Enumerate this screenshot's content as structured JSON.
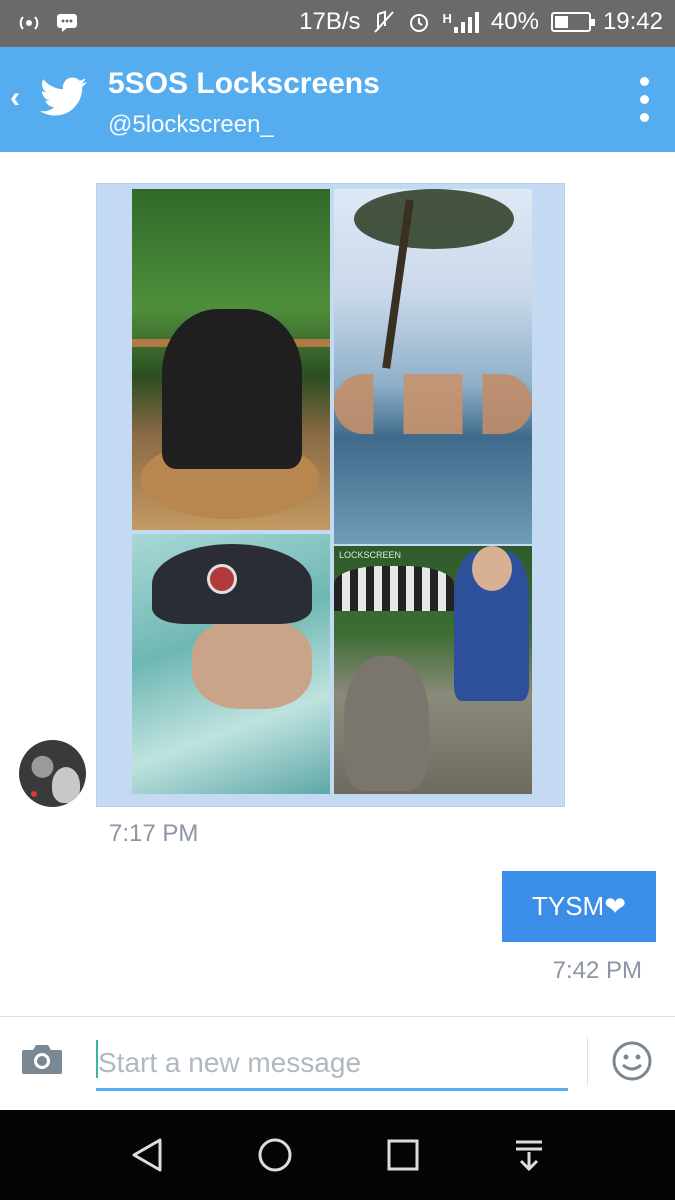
{
  "status_bar": {
    "speed": "17B/s",
    "network_type": "H",
    "battery_percent": "40%",
    "battery_level": 0.4,
    "time": "19:42",
    "icons": [
      "hotspot-icon",
      "bbm-icon",
      "mute-icon",
      "alarm-icon",
      "signal-icon",
      "battery-icon"
    ]
  },
  "header": {
    "title": "5SOS Lockscreens",
    "handle": "@5lockscreen_",
    "accent": "#55acee"
  },
  "conversation": {
    "incoming": {
      "image_watermark": "LOCKSCREEN",
      "time": "7:17 PM"
    },
    "outgoing": {
      "text": "TYSM❤",
      "time": "7:42 PM",
      "color": "#3a8ee8"
    }
  },
  "composer": {
    "placeholder": "Start a new message",
    "value": ""
  },
  "nav_bar": {
    "icons": [
      "back-icon",
      "home-icon",
      "recents-icon",
      "notifications-icon"
    ]
  }
}
